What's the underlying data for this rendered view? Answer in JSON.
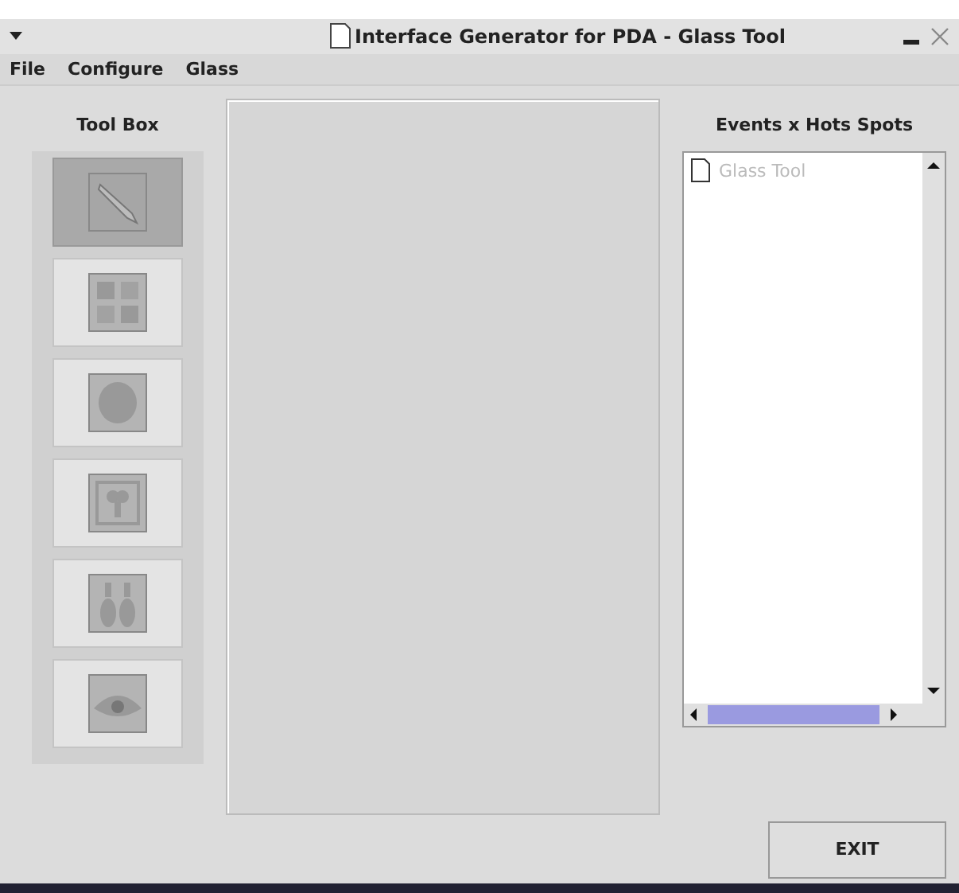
{
  "window": {
    "title": "Interface Generator for PDA - Glass Tool"
  },
  "menu": [
    "File",
    "Configure",
    "Glass"
  ],
  "toolbox": {
    "title": "Tool Box",
    "tools": [
      {
        "kind": "pen",
        "selected": true
      },
      {
        "kind": "grid",
        "selected": false
      },
      {
        "kind": "circle",
        "selected": false
      },
      {
        "kind": "figure",
        "selected": false
      },
      {
        "kind": "bottles",
        "selected": false
      },
      {
        "kind": "eye",
        "selected": false
      }
    ]
  },
  "events": {
    "title": "Events x Hots Spots",
    "items": [
      "Glass Tool"
    ]
  },
  "buttons": [
    "EXIT"
  ]
}
